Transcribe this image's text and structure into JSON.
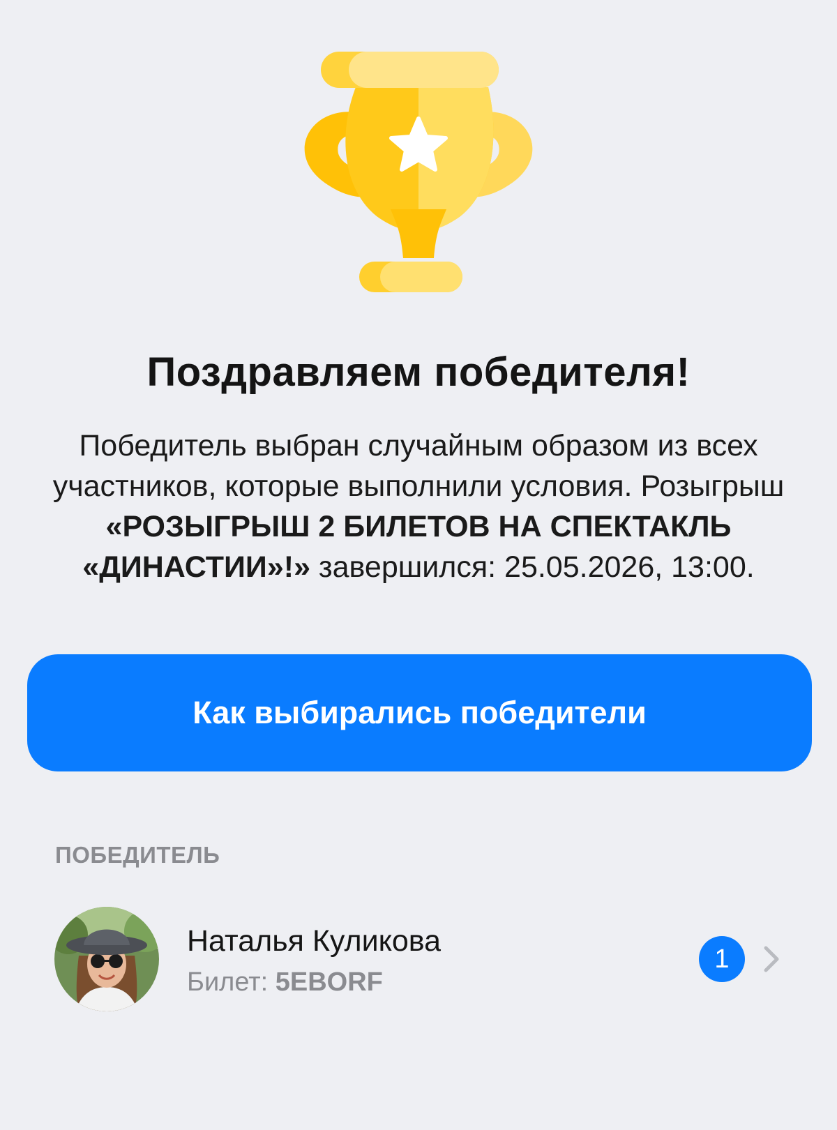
{
  "header": {
    "title": "Поздравляем победителя!"
  },
  "description": {
    "text_before": "Победитель выбран случайным образом из всех участников, которые выполнили условия. Розыгрыш ",
    "giveaway_name": "«РОЗЫГРЫШ 2 БИЛЕТОВ НА СПЕКТАКЛЬ «ДИНАСТИИ»!»",
    "text_after": " завершился: 25.05.2026, 13:00."
  },
  "actions": {
    "how_selected_label": "Как выбирались победители"
  },
  "winners_section": {
    "label": "ПОБЕДИТЕЛЬ",
    "winner": {
      "name": "Наталья Куликова",
      "ticket_label": "Билет: ",
      "ticket_code": "5EBORF",
      "place": "1"
    }
  },
  "icons": {
    "trophy": "trophy-icon",
    "chevron": "chevron-right-icon"
  },
  "colors": {
    "accent": "#0a7cff",
    "background": "#eeeff3",
    "muted_text": "#8a8b90",
    "trophy_gold": "#ffc91a"
  }
}
